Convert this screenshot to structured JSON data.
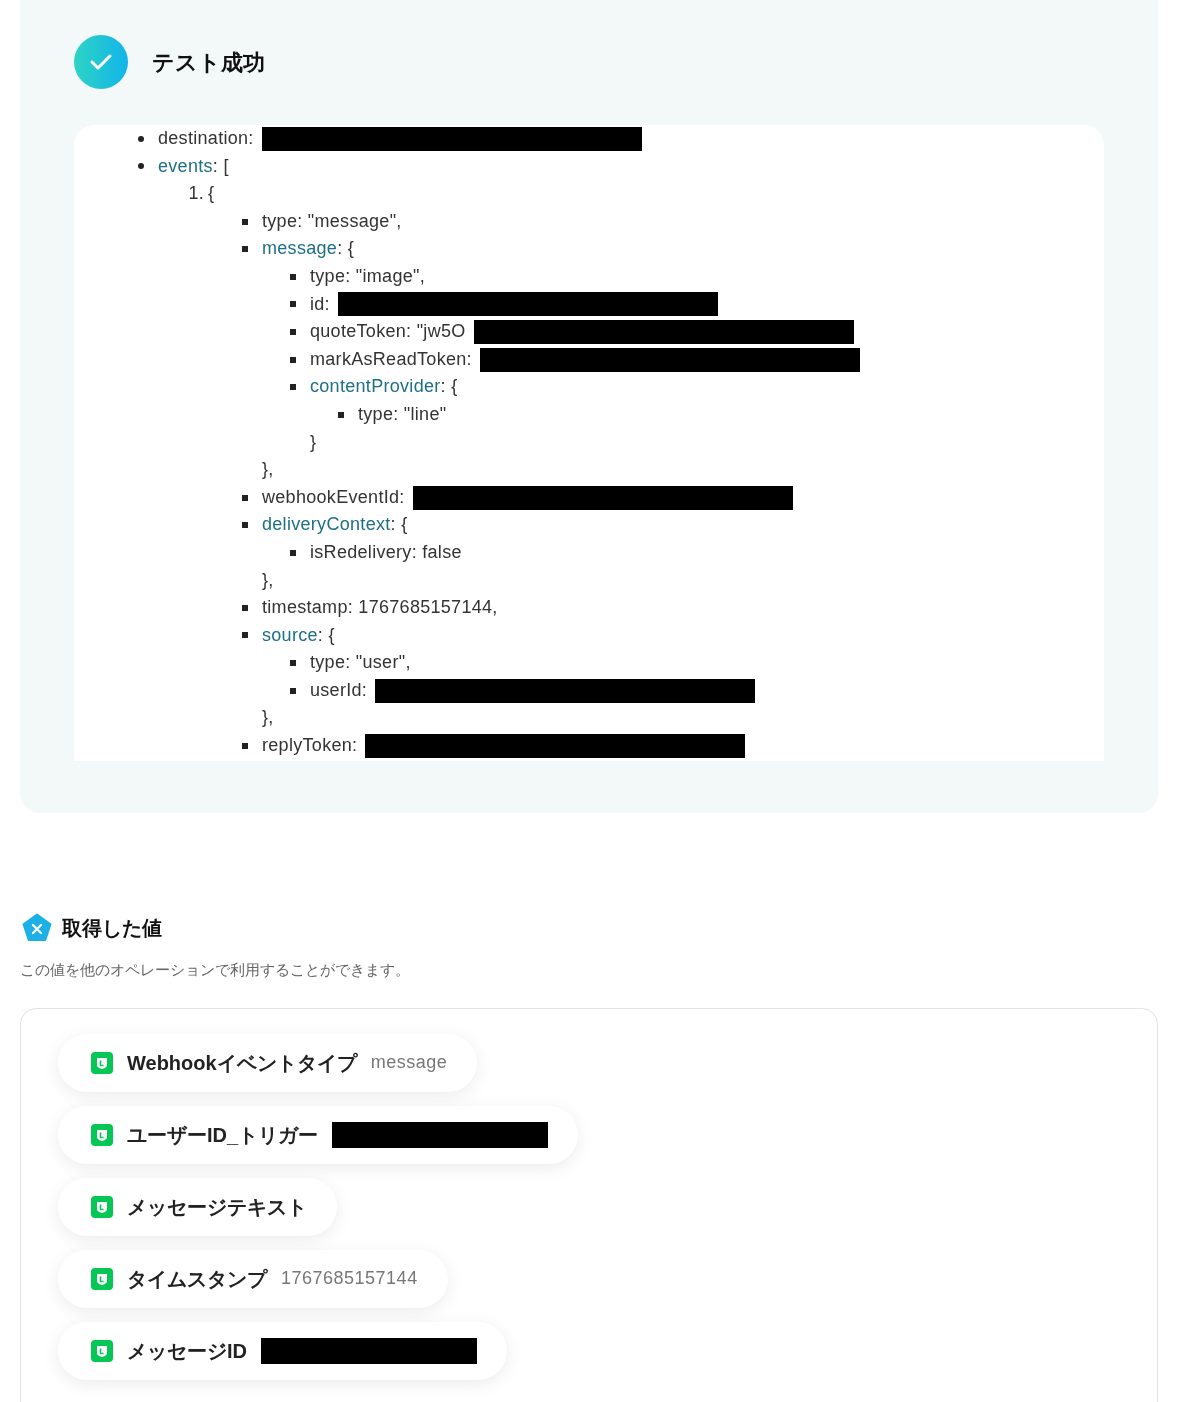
{
  "result": {
    "title": "テスト成功",
    "tree": [
      {
        "kind": "redacted",
        "key": "destination",
        "value": ":"
      },
      {
        "kind": "object",
        "key": "events",
        "value": ": [",
        "children": [
          {
            "kind": "index",
            "key": "1.",
            "value": "{",
            "children": [
              {
                "kind": "value",
                "key": "type",
                "value": ": \"message\","
              },
              {
                "kind": "object",
                "key": "message",
                "value": ": {",
                "close": "},",
                "children": [
                  {
                    "kind": "value",
                    "key": "type",
                    "value": ": \"image\","
                  },
                  {
                    "kind": "redacted",
                    "key": "id",
                    "value": ":"
                  },
                  {
                    "kind": "redacted",
                    "key": "quoteToken",
                    "value": ": \"jw5O"
                  },
                  {
                    "kind": "redacted",
                    "key": "markAsReadToken",
                    "value": ":"
                  },
                  {
                    "kind": "object",
                    "key": "contentProvider",
                    "value": ": {",
                    "close": "}",
                    "children": [
                      {
                        "kind": "value",
                        "key": "type",
                        "value": ": \"line\""
                      }
                    ]
                  }
                ]
              },
              {
                "kind": "redacted",
                "key": "webhookEventId",
                "value": ":"
              },
              {
                "kind": "object",
                "key": "deliveryContext",
                "value": ": {",
                "close": "},",
                "children": [
                  {
                    "kind": "value",
                    "key": "isRedelivery",
                    "value": ": false"
                  }
                ]
              },
              {
                "kind": "value",
                "key": "timestamp",
                "value": ": 1767685157144,"
              },
              {
                "kind": "object",
                "key": "source",
                "value": ": {",
                "close": "},",
                "children": [
                  {
                    "kind": "value",
                    "key": "type",
                    "value": ": \"user\","
                  },
                  {
                    "kind": "redacted",
                    "key": "userId",
                    "value": ":"
                  }
                ]
              },
              {
                "kind": "redacted",
                "key": "replyToken",
                "value": ":"
              }
            ]
          }
        ]
      }
    ]
  },
  "values": {
    "title": "取得した値",
    "description": "この値を他のオペレーションで利用することができます。",
    "items": [
      {
        "label": "Webhookイベントタイプ",
        "value": "message"
      },
      {
        "label": "ユーザーID_トリガー",
        "redacted": true
      },
      {
        "label": "メッセージテキスト"
      },
      {
        "label": "タイムスタンプ",
        "value": "1767685157144"
      },
      {
        "label": "メッセージID",
        "redacted": true
      }
    ]
  }
}
